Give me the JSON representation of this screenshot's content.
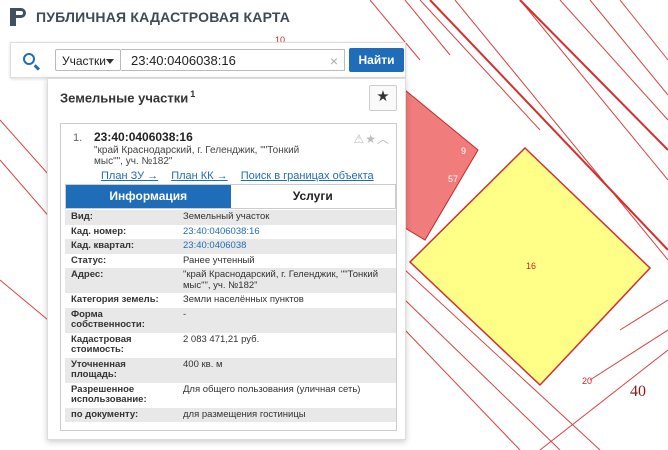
{
  "app": {
    "title": "ПУБЛИЧНАЯ КАДАСТРОВАЯ КАРТА"
  },
  "search": {
    "type_selected": "Участки",
    "query": "23:40:0406038:16",
    "find_label": "Найти",
    "clear_glyph": "×"
  },
  "panel": {
    "title": "Земельные участки",
    "count": "1"
  },
  "parcel": {
    "index": "1.",
    "cad_number": "23:40:0406038:16",
    "address": "\"край Краснодарский, г. Геленджик, \"\"Тонкий мыс\"\", уч. №182\"",
    "links": [
      "План ЗУ →",
      "План КК →",
      "Поиск в границах объекта →"
    ],
    "tabs": [
      "Информация",
      "Услуги"
    ]
  },
  "properties": [
    {
      "key": "Вид:",
      "value": "Земельный участок"
    },
    {
      "key": "Кад. номер:",
      "value": "23:40:0406038:16"
    },
    {
      "key": "Кад. квартал:",
      "value": "23:40:0406038"
    },
    {
      "key": "Статус:",
      "value": "Ранее учтенный"
    },
    {
      "key": "Адрес:",
      "value": "\"край Краснодарский, г. Геленджик, \"\"Тонкий мыс\"\", уч. №182\""
    },
    {
      "key": "Категория земель:",
      "value": "Земли населённых пунктов"
    },
    {
      "key": "Форма собственности:",
      "value": "-"
    },
    {
      "key": "Кадастровая стоимость:",
      "value": "2 083 471,21 руб."
    },
    {
      "key": "Уточненная площадь:",
      "value": "400 кв. м"
    },
    {
      "key": "Разрешенное использование:",
      "value": "Для общего пользования (уличная сеть)"
    },
    {
      "key": "по документу:",
      "value": "для размещения гостиницы"
    }
  ],
  "map": {
    "labels": [
      "10",
      "9",
      "57",
      "16",
      "20",
      "40"
    ],
    "colors": {
      "parcel_highlight": "#ffff88",
      "parcel_red": "#f07c7c",
      "boundary": "#d32f2f"
    }
  }
}
